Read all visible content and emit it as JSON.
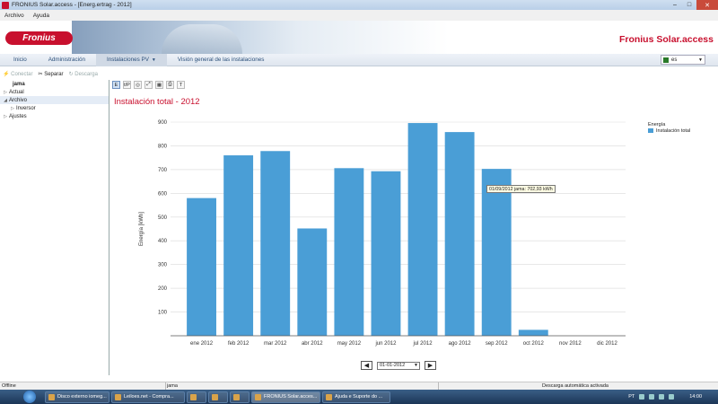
{
  "window": {
    "title": "FRONIUS Solar.access - [Energ.ertrag - 2012]",
    "min": "–",
    "max": "□",
    "close": "✕"
  },
  "menu": [
    "Archivo",
    "Ayuda"
  ],
  "banner": {
    "logo": "Fronius",
    "brand": "Fronius Solar.access"
  },
  "nav": {
    "tabs": [
      "Inicio",
      "Administración",
      "Instalaciones PV",
      "Visión general de las instalaciones"
    ],
    "language": "es"
  },
  "toolbar": {
    "connect": "Conectar",
    "disconnect": "Separar",
    "download": "Descarga"
  },
  "tree": [
    {
      "label": "jama",
      "level": 0,
      "bold": true
    },
    {
      "label": "Actual",
      "level": 0,
      "exp": "▷"
    },
    {
      "label": "Archivo",
      "level": 0,
      "exp": "◢",
      "selected": true
    },
    {
      "label": "Inversor",
      "level": 1,
      "exp": "▷"
    },
    {
      "label": "Ajustes",
      "level": 0,
      "exp": "▷"
    }
  ],
  "view_tools": [
    "E",
    "t/P",
    "◎",
    "⤢",
    "▦",
    "⎙",
    "T"
  ],
  "chart_title": "Instalación total - 2012",
  "chart_data": {
    "type": "bar",
    "categories": [
      "ene 2012",
      "feb 2012",
      "mar 2012",
      "abr 2012",
      "may 2012",
      "jun 2012",
      "jul 2012",
      "ago 2012",
      "sep 2012",
      "oct 2012",
      "nov 2012",
      "dic 2012"
    ],
    "series": [
      {
        "name": "Instalación total",
        "values": [
          580,
          760,
          778,
          452,
          706,
          693,
          896,
          858,
          702.93,
          25,
          0,
          0
        ]
      }
    ],
    "ylabel": "Energía [kWh]",
    "ylim": [
      0,
      900
    ],
    "yticks": [
      100,
      200,
      300,
      400,
      500,
      600,
      700,
      800,
      900
    ],
    "grid": true,
    "legend_title": "Energía",
    "legend_position": "right",
    "bar_color": "#4a9ed6"
  },
  "tooltip": "01/09/2012 jama: 702,93 kWh",
  "pager": {
    "prev": "◀",
    "next": "▶",
    "date": "01-01-2012"
  },
  "status": {
    "left": "Offline",
    "mid": "jama",
    "right": "Descarga automática activada"
  },
  "taskbar": {
    "items": [
      "Disco externo iomeg...",
      "Leiloes.net - Compra...",
      "",
      "",
      "",
      "FRONIUS Solar.acces...",
      "Ajuda e Suporte do ..."
    ],
    "lang": "PT",
    "time": "14:00"
  }
}
